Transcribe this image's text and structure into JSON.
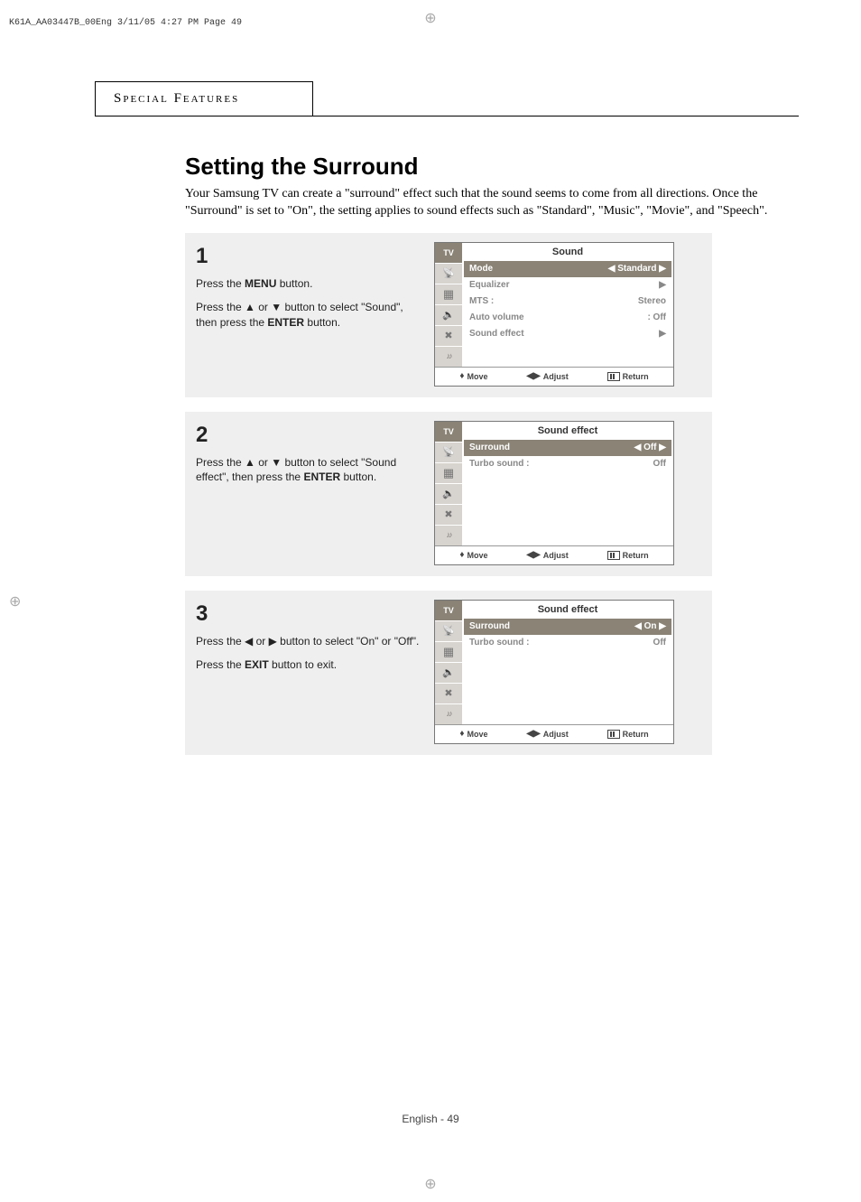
{
  "running_head": "K61A_AA03447B_00Eng  3/11/05  4:27 PM  Page 49",
  "tab_title": "Special Features",
  "title": "Setting the Surround",
  "intro": "Your Samsung TV can create a \"surround\" effect such that the sound seems to come from all directions. Once the \"Surround\" is set to \"On\", the setting applies to sound effects such as \"Standard\", \"Music\", \"Movie\", and \"Speech\".",
  "footer": "English - 49",
  "steps": [
    {
      "num": "1",
      "lines": [
        {
          "pre": "Press the ",
          "bold": "MENU",
          "post": " button."
        },
        {
          "pre": "Press the ▲ or ▼ button to select \"Sound\", then press the ",
          "bold": "ENTER",
          "post": " button."
        }
      ]
    },
    {
      "num": "2",
      "lines": [
        {
          "pre": "Press the ▲ or ▼ button to select \"Sound effect\", then press the ",
          "bold": "ENTER",
          "post": " button."
        }
      ]
    },
    {
      "num": "3",
      "lines": [
        {
          "pre": "Press the ◀ or ▶ button to select \"On\" or \"Off\"."
        },
        {
          "pre": "Press the ",
          "bold": "EXIT",
          "post": " button to exit."
        }
      ]
    }
  ],
  "osd_side_label": "TV",
  "osd1": {
    "title": "Sound",
    "rows": [
      {
        "lab": "Mode",
        "val": "◀  Standard  ▶",
        "sel": true
      },
      {
        "lab": "Equalizer",
        "val": "▶"
      },
      {
        "lab": "MTS          :",
        "val": "Stereo"
      },
      {
        "lab": "Auto volume",
        "val": ": Off"
      },
      {
        "lab": "Sound effect",
        "val": "▶"
      }
    ]
  },
  "osd2": {
    "title": "Sound effect",
    "rows": [
      {
        "lab": "Surround",
        "val": "◀    Off    ▶",
        "sel": true
      },
      {
        "lab": "Turbo sound     :",
        "val": "Off"
      }
    ]
  },
  "osd3": {
    "title": "Sound effect",
    "rows": [
      {
        "lab": "Surround",
        "val": "◀    On    ▶",
        "sel": true
      },
      {
        "lab": "Turbo sound     :",
        "val": "Off"
      }
    ]
  },
  "osd_foot": {
    "move": "Move",
    "adjust": "Adjust",
    "return": "Return"
  }
}
